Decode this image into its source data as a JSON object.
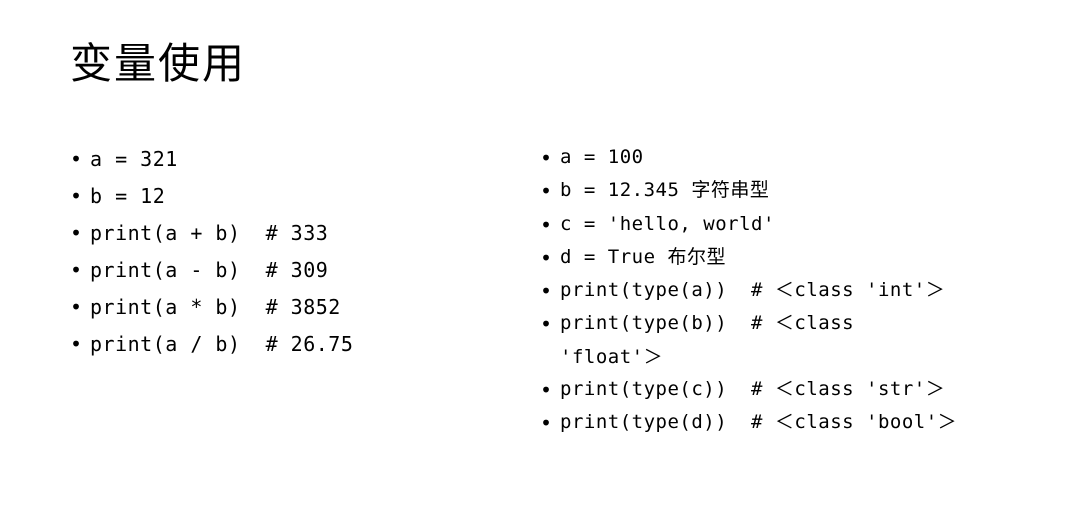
{
  "title": "变量使用",
  "left": {
    "l1": "a = 321",
    "l2": "b = 12",
    "l3": "print(a + b)  # 333",
    "l4": "print(a - b)  # 309",
    "l5": "print(a * b)  # 3852",
    "l6": "print(a / b)  # 26.75"
  },
  "right": {
    "r1": "a = 100",
    "r2": "b = 12.345 字符串型",
    "r3": "c = 'hello, world'",
    "r4": "d = True 布尔型",
    "r5": "print(type(a))  # ＜class 'int'＞",
    "r6": "print(type(b))  # ＜class",
    "r6b": "'float'＞",
    "r7": "print(type(c))  # ＜class 'str'＞",
    "r8": "print(type(d))  # ＜class 'bool'＞"
  }
}
